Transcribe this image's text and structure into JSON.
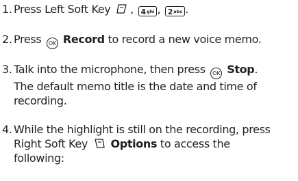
{
  "steps": [
    {
      "num": "1.",
      "pre": "Press Left Soft Key",
      "comma": ",",
      "key4": "4",
      "key4_sub": "ghi",
      "key2": "2",
      "key2_sub": "abc",
      "end": "."
    },
    {
      "num": "2.",
      "pre": "Press",
      "ok": "OK",
      "bold": "Record",
      "post": "to record a new voice memo."
    },
    {
      "num": "3.",
      "pre": "Talk into the microphone, then press",
      "ok": "OK",
      "bold": "Stop",
      "end": ".",
      "line2": "The default memo title is the date and time of",
      "line3": "recording."
    },
    {
      "num": "4.",
      "line1": "While the highlight is still on the recording, press",
      "pre": "Right Soft Key",
      "bold": "Options",
      "post": "to access the",
      "line3": "following:"
    }
  ],
  "icons": {
    "left_soft": "left-soft-key-icon",
    "right_soft": "right-soft-key-icon",
    "ok": "ok-key-icon"
  }
}
